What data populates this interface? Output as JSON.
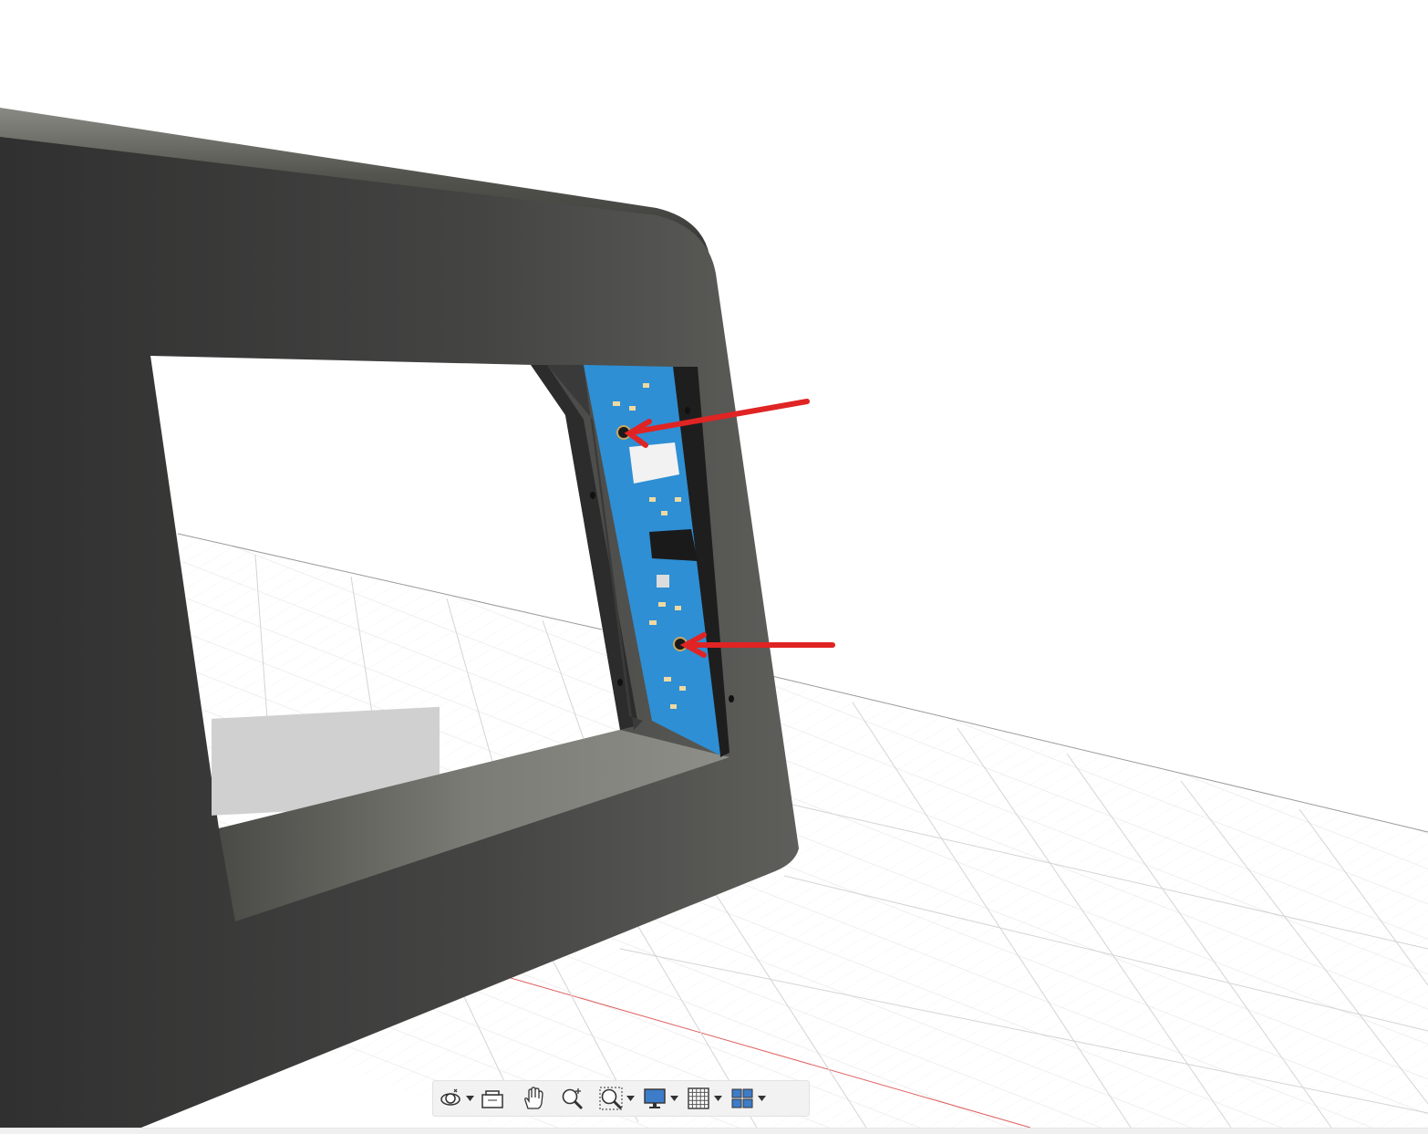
{
  "viewport": {
    "background": "#ffffff",
    "model": {
      "body_color": "#404040",
      "pcb_color": "#2b8fd6"
    },
    "annotations": {
      "arrow_color": "#e02424"
    },
    "grid": {
      "minor_line_color": "#e7e7e7",
      "major_line_color": "#d0d0d0",
      "x_axis_color": "#e04040"
    }
  },
  "navigation_toolbar": {
    "buttons": [
      {
        "name": "orbit",
        "icon": "orbit-icon",
        "has_dropdown": true
      },
      {
        "name": "look-at",
        "icon": "look-at-icon",
        "has_dropdown": false
      },
      {
        "name": "pan",
        "icon": "pan-hand-icon",
        "has_dropdown": false
      },
      {
        "name": "zoom",
        "icon": "zoom-icon",
        "has_dropdown": false
      },
      {
        "name": "fit",
        "icon": "zoom-window-icon",
        "has_dropdown": true
      },
      {
        "name": "display-settings",
        "icon": "monitor-icon",
        "has_dropdown": true
      },
      {
        "name": "grid-and-snaps",
        "icon": "grid-icon",
        "has_dropdown": true
      },
      {
        "name": "viewports",
        "icon": "viewports-icon",
        "has_dropdown": true
      }
    ]
  }
}
